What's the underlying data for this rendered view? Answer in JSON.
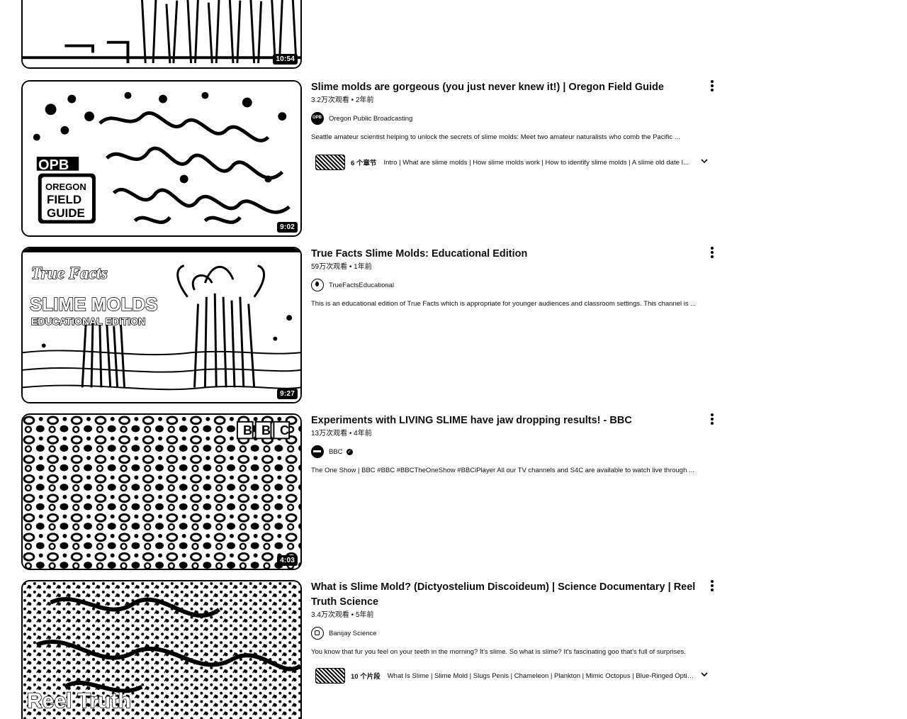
{
  "videos": [
    {
      "duration": "10:54",
      "title": "",
      "meta": "",
      "channel": "",
      "description": ""
    },
    {
      "duration": "9:02",
      "title": "Slime molds are gorgeous (you just never knew it!) | Oregon Field Guide",
      "meta": "3.2万次观看 • 2年前",
      "channel": "Oregon Public Broadcasting",
      "avatar_text": "OPB",
      "description": "Seattle amateur scientist helping to unlock the secrets of slime molds: Meet two amateur naturalists who comb the Pacific ...",
      "chapters_count": "6 个章节",
      "chapters_text": "Intro | What are slime molds | How slime molds work | How to identify slime molds | A slime old date I...",
      "thumb_text": [
        "OPB",
        "OREGON",
        "FIELD",
        "GUIDE"
      ]
    },
    {
      "duration": "9:27",
      "title": "True Facts Slime Molds: Educational Edition",
      "meta": "59万次观看 • 1年前",
      "channel": "TrueFactsEducational",
      "description": "This is an educational edition of True Facts which is appropriate for younger audiences and classroom settings. This channel is ...",
      "thumb_text": [
        "True Facts",
        "SLIME MOLDS",
        "EDUCATIONAL EDITION"
      ]
    },
    {
      "duration": "4:03",
      "title": "Experiments with LIVING SLIME have jaw dropping results! - BBC",
      "meta": "13万次观看 • 4年前",
      "channel": "BBC",
      "verified": "✓",
      "description": "The One Show | BBC #BBC #BBCTheOneShow #BBCiPlayer All our TV channels and S4C are available to watch live through ...",
      "thumb_text": [
        "B",
        "B",
        "C"
      ]
    },
    {
      "duration": "",
      "title": "What is Slime Mold? (Dictyostelium Discoideum) | Science Documentary | Reel Truth Science",
      "meta": "3.4万次观看 • 5年前",
      "channel": "Banijay Science",
      "description": "You know that fur you feel on your teeth in the morning? It's slime. So what is slime? It's fascinating goo that's full of surprises.",
      "chapters_count": "10 个片段",
      "chapters_text": "What Is Slime | Slime Mold | Slugs Penis | Chameleon | Plankton | Mimic Octopus | Blue-Ringed Optimis...",
      "thumb_text": [
        "Reel Truth"
      ]
    }
  ],
  "icons": {
    "more": "more-vert-icon",
    "expand": "chevron-down-icon"
  }
}
